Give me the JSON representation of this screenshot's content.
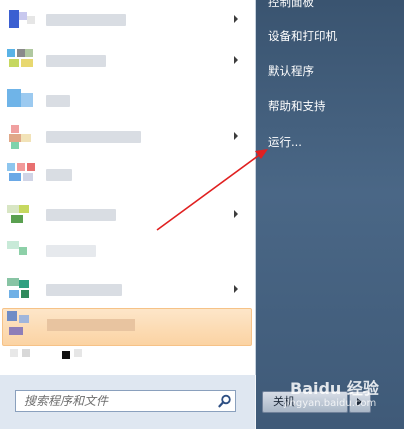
{
  "right_menu": {
    "items": [
      {
        "label": "控制面板"
      },
      {
        "label": "设备和打印机"
      },
      {
        "label": "默认程序"
      },
      {
        "label": "帮助和支持"
      },
      {
        "label": "运行..."
      }
    ],
    "shutdown_label": "关机"
  },
  "search": {
    "placeholder": "搜索程序和文件"
  },
  "watermark": {
    "text": "Baidu 经验",
    "sub": "jingyan.baidu.com"
  },
  "colors": {
    "annotation_arrow": "#e02020",
    "highlight": "#fbd3a3",
    "right_pane": "#4a6786"
  },
  "program_list": {
    "item_count": 10,
    "highlighted_index": 10
  }
}
